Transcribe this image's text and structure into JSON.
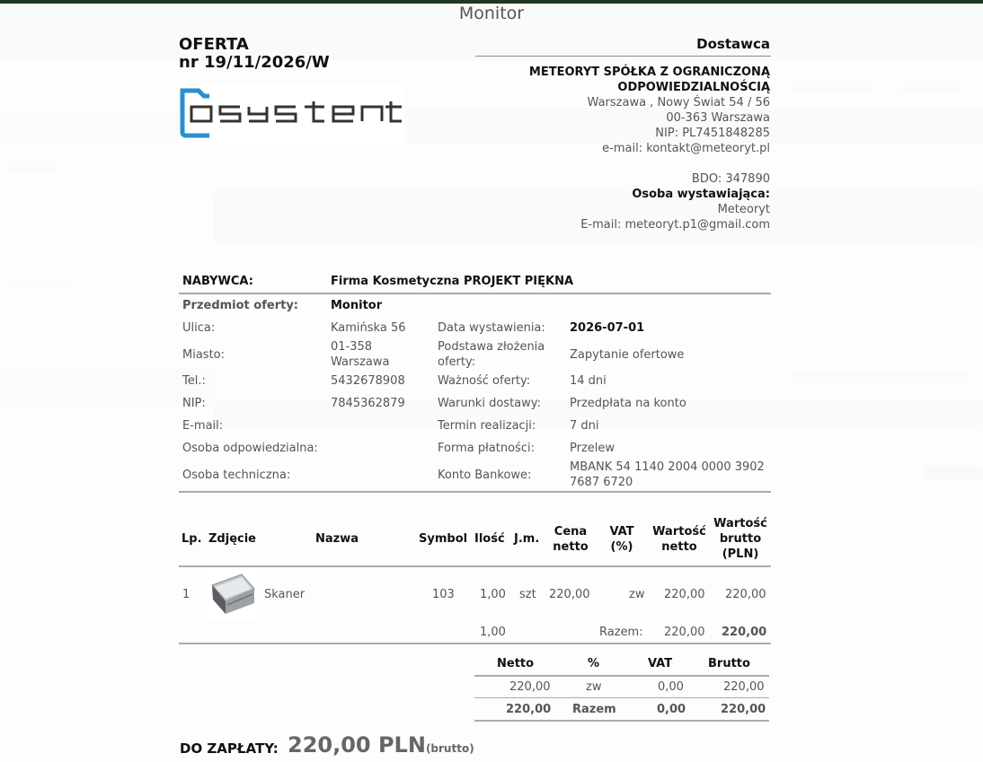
{
  "window": {
    "title": "Monitor"
  },
  "offer": {
    "title_line1": "OFERTA",
    "title_line2": "nr 19/11/2026/W"
  },
  "logo": {
    "text": "asystent",
    "color": "#2a8fd0"
  },
  "supplier": {
    "heading": "Dostawca",
    "name_line1": "METEORYT SPÓŁKA Z OGRANICZONĄ",
    "name_line2": "ODPOWIEDZIALNOŚCIĄ",
    "address_line1": "Warszawa , Nowy Świat 54 / 56",
    "address_line2": "00-363 Warszawa",
    "nip": "NIP: PL7451848285",
    "email": "e-mail: kontakt@meteoryt.pl",
    "bdo": "BDO: 347890",
    "issuer_label": "Osoba wystawiająca:",
    "issuer_name": "Meteoryt",
    "issuer_email": "E-mail: meteoryt.p1@gmail.com"
  },
  "buyer": {
    "label": "NABYWCA:",
    "name": "Firma Kosmetyczna PROJEKT PIĘKNA",
    "subject_label": "Przedmiot oferty:",
    "subject_value": "Monitor",
    "street_label": "Ulica:",
    "street_value": "Kamińska 56",
    "city_label": "Miasto:",
    "city_value_line1": "01-358",
    "city_value_line2": "Warszawa",
    "phone_label": "Tel.:",
    "phone_value": "5432678908",
    "nip_label": "NIP:",
    "nip_value": "7845362879",
    "email_label": "E-mail:",
    "responsible_label": "Osoba odpowiedzialna:",
    "technical_label": "Osoba techniczna:"
  },
  "details": {
    "issue_date_label": "Data wystawienia:",
    "issue_date_value": "2026-07-01",
    "basis_label_line1": "Podstawa złożenia",
    "basis_label_line2": "oferty:",
    "basis_value": "Zapytanie ofertowe",
    "validity_label": "Ważność oferty:",
    "validity_value": "14 dni",
    "delivery_label": "Warunki dostawy:",
    "delivery_value": "Przedpłata na konto",
    "term_label": "Termin realizacji:",
    "term_value": "7 dni",
    "payment_label": "Forma płatności:",
    "payment_value": "Przelew",
    "account_label": "Konto Bankowe:",
    "account_value_line1": "MBANK 54 1140 2004 0000 3902",
    "account_value_line2": "7687 6720"
  },
  "items_table": {
    "headers": {
      "lp": "Lp.",
      "photo": "Zdjęcie",
      "name": "Nazwa",
      "symbol": "Symbol",
      "qty": "Ilość",
      "unit": "J.m.",
      "net_price_1": "Cena",
      "net_price_2": "netto",
      "vat_1": "VAT",
      "vat_2": "(%)",
      "net_value_1": "Wartość",
      "net_value_2": "netto",
      "gross_value_1": "Wartość",
      "gross_value_2": "brutto",
      "gross_value_3": "(PLN)"
    },
    "rows": [
      {
        "lp": "1",
        "name": "Skaner",
        "symbol": "103",
        "qty": "1,00",
        "unit": "szt",
        "net_price": "220,00",
        "vat": "zw",
        "net_value": "220,00",
        "gross_value": "220,00",
        "photo_icon": "scanner-photo"
      }
    ],
    "total": {
      "qty": "1,00",
      "label": "Razem:",
      "net_value": "220,00",
      "gross_value": "220,00"
    }
  },
  "summary_table": {
    "headers": {
      "net": "Netto",
      "pct": "%",
      "vat": "VAT",
      "gross": "Brutto"
    },
    "row": {
      "net": "220,00",
      "pct": "zw",
      "vat": "0,00",
      "gross": "220,00"
    },
    "total": {
      "net": "220,00",
      "label": "Razem",
      "vat": "0,00",
      "gross": "220,00"
    }
  },
  "to_pay": {
    "label": "DO ZAPŁATY:",
    "amount": "220,00 PLN",
    "unit": "(brutto)"
  },
  "colors": {
    "top_bar": "#1f3a23",
    "background": "#edf2ed"
  }
}
